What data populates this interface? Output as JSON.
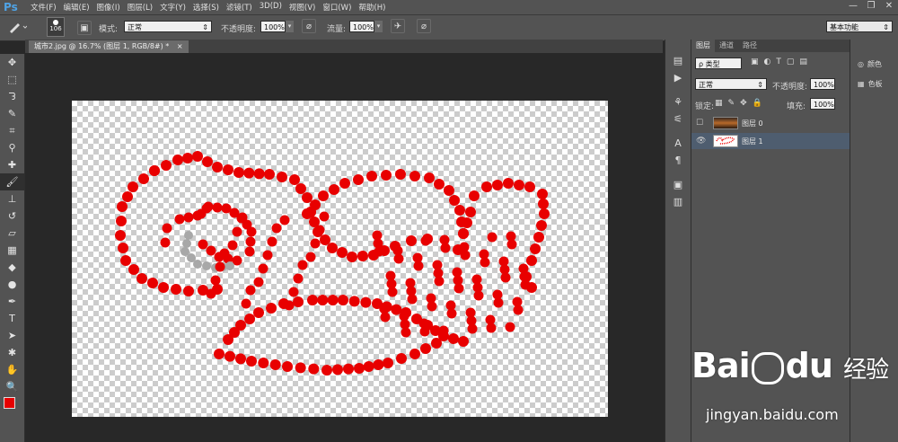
{
  "app": {
    "logo": "Ps"
  },
  "menu": [
    "文件(F)",
    "编辑(E)",
    "图像(I)",
    "图层(L)",
    "文字(Y)",
    "选择(S)",
    "滤镜(T)",
    "3D(D)",
    "视图(V)",
    "窗口(W)",
    "帮助(H)"
  ],
  "window": {
    "min": "—",
    "max": "❐",
    "close": "✕"
  },
  "options": {
    "brush_size": "106",
    "mode_label": "模式:",
    "mode_value": "正常",
    "opacity_label": "不透明度:",
    "opacity_value": "100%",
    "flow_label": "流量:",
    "flow_value": "100%",
    "workspace": "基本功能"
  },
  "doc_tab": {
    "label": "城市2.jpg @ 16.7% (图层 1, RGB/8#) *",
    "close": "×"
  },
  "layers_panel": {
    "tabs": [
      "图层",
      "通道",
      "路径"
    ],
    "filter_label": "ρ 类型",
    "blend_mode": "正常",
    "opacity_label": "不透明度:",
    "opacity_value": "100%",
    "lock_label": "锁定:",
    "fill_label": "填充:",
    "fill_value": "100%",
    "layers": [
      {
        "name": "图层 0",
        "visible": false,
        "selected": false
      },
      {
        "name": "图层 1",
        "visible": true,
        "selected": true
      }
    ]
  },
  "right_panel": [
    {
      "label": "颜色",
      "icon": "palette-icon"
    },
    {
      "label": "色板",
      "icon": "swatches-icon"
    }
  ],
  "colors": {
    "foreground": "#e60000",
    "background": "#ffffff",
    "dots": "#e80000",
    "gray_dots": "#a8a8a8"
  },
  "watermark": {
    "brand": "Bai",
    "brand2": "du",
    "cn": "经验",
    "url": "jingyan.baidu.com"
  }
}
